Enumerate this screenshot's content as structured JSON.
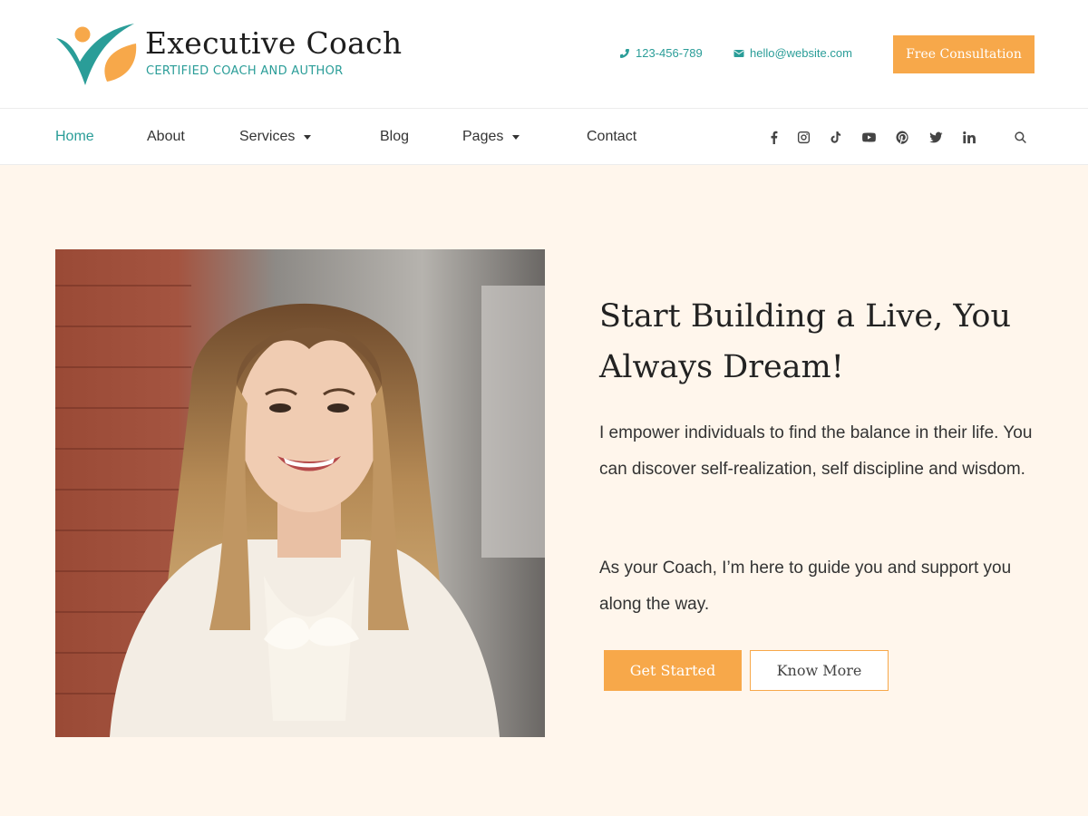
{
  "brand": {
    "title": "Executive Coach",
    "tagline": "CERTIFIED COACH AND AUTHOR",
    "logo_icon": "check-leaf-logo"
  },
  "header": {
    "phone": "123-456-789",
    "email": "hello@website.com",
    "cta_label": "Free Consultation"
  },
  "nav": {
    "items": [
      {
        "label": "Home",
        "active": true
      },
      {
        "label": "About"
      },
      {
        "label": "Services",
        "has_dropdown": true
      },
      {
        "label": "Blog"
      },
      {
        "label": "Pages",
        "has_dropdown": true
      },
      {
        "label": "Contact"
      }
    ],
    "social_icons": [
      "facebook-icon",
      "instagram-icon",
      "tiktok-icon",
      "youtube-icon",
      "pinterest-icon",
      "twitter-icon",
      "linkedin-icon"
    ],
    "search_icon": "search-icon"
  },
  "hero": {
    "headline": "Start Building a Live, You Always Dream!",
    "paragraph_1": "I empower individuals to find the balance in their life. You can discover self-realization, self discipline and wisdom.",
    "paragraph_2": "As your Coach, I’m here to guide you and support you along the way.",
    "primary_button": "Get Started",
    "secondary_button": "Know More"
  },
  "colors": {
    "accent_teal": "#2a9d98",
    "accent_orange": "#f7a84a",
    "hero_background": "#fff6ec"
  }
}
